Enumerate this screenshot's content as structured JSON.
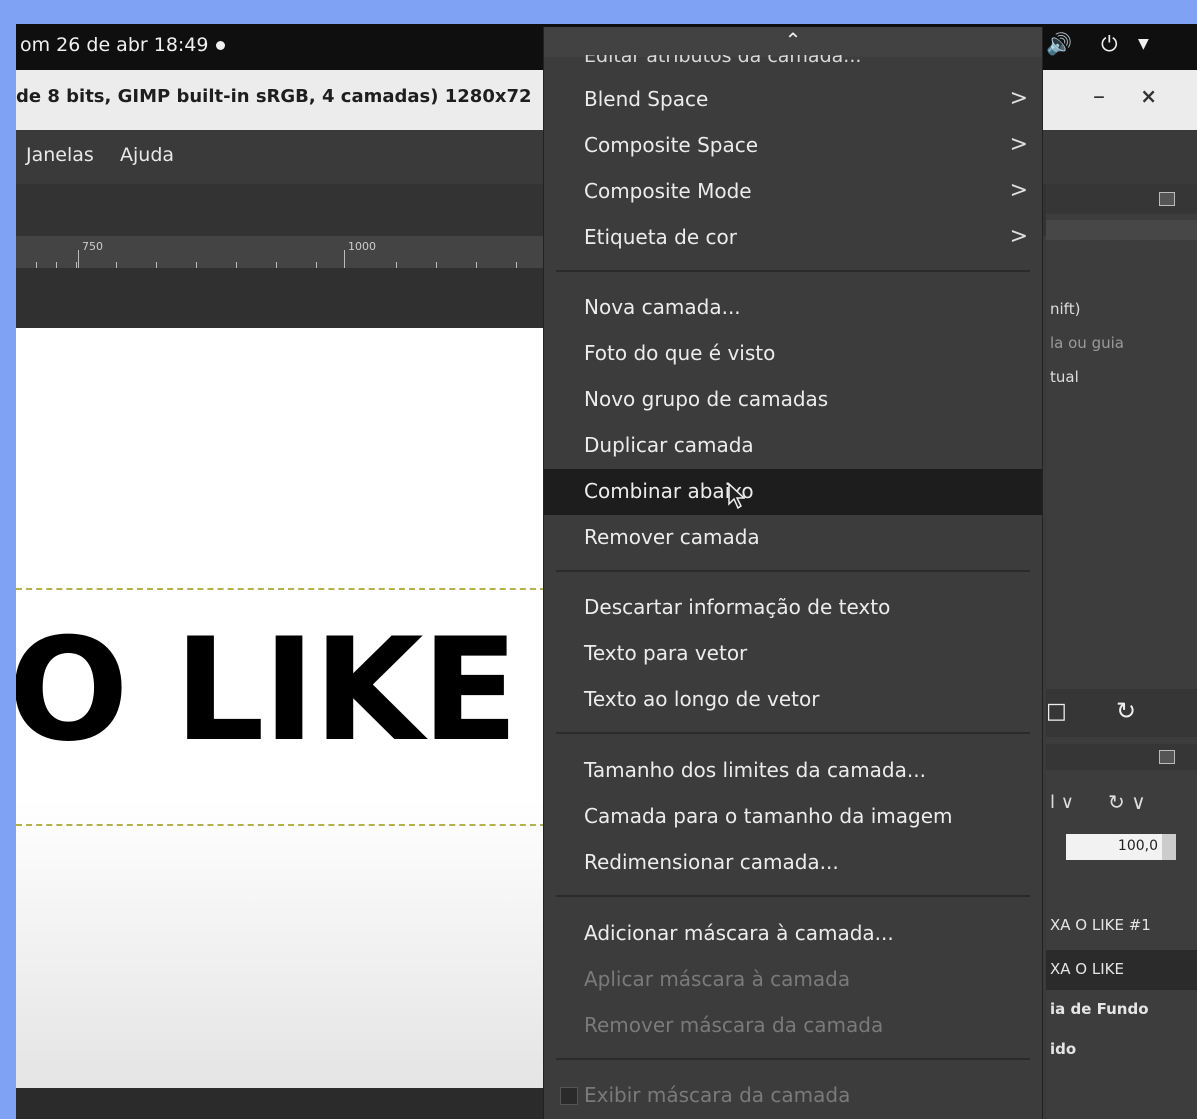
{
  "topbar": {
    "clock": "om 26 de abr 18:49",
    "volume_icon": "speaker-icon",
    "power_icon": "power-icon",
    "menu_icon": "chevron-down-icon"
  },
  "window": {
    "title": "de 8 bits, GIMP built-in sRGB, 4 camadas) 1280x72",
    "minimize": "–",
    "close": "×"
  },
  "menubar": {
    "items": [
      "Janelas",
      "Ajuda"
    ]
  },
  "ruler": {
    "labels": [
      "750",
      "1000"
    ]
  },
  "canvas": {
    "text": "O LIKE"
  },
  "dock": {
    "hint_lines": [
      "nift)",
      "la ou guia",
      "tual"
    ],
    "icon_a": "□",
    "icon_b": "↻",
    "mode_chevron": "∨",
    "opacity_value": "100,0",
    "layers": [
      "XA O LIKE #1",
      "XA O LIKE",
      "ia de Fundo",
      "ido"
    ]
  },
  "menu": {
    "scroll_up_glyph": "⌃",
    "cut_item": "Editar atributos da camada...",
    "submenus": [
      "Blend Space",
      "Composite Space",
      "Composite Mode",
      "Etiqueta de cor"
    ],
    "group1": [
      "Nova camada...",
      "Foto do que é visto",
      "Novo grupo de camadas",
      "Duplicar camada",
      "Combinar abaixo",
      "Remover camada"
    ],
    "group2": [
      "Descartar informação de texto",
      "Texto para vetor",
      "Texto ao longo de vetor"
    ],
    "group3": [
      "Tamanho dos limites da camada...",
      "Camada para o tamanho da imagem",
      "Redimensionar camada..."
    ],
    "group4": [
      "Adicionar máscara à camada...",
      "Aplicar máscara à camada",
      "Remover máscara da camada"
    ],
    "group5": [
      "Exibir máscara da camada"
    ],
    "submenu_arrow": ">",
    "hovered_item": "Combinar abaixo"
  },
  "colors": {
    "desktop_bg": "#7fa2f5",
    "menu_bg": "#3c3c3c",
    "hover_bg": "#1d1d1d",
    "canvas_guide": "#b4b04a"
  }
}
